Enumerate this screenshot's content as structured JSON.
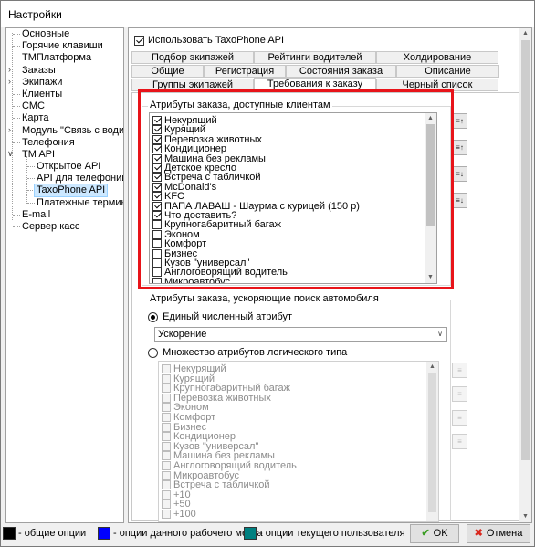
{
  "window": {
    "title": "Настройки"
  },
  "tree": [
    {
      "label": "Основные"
    },
    {
      "label": "Горячие клавиши"
    },
    {
      "label": "ТМПлатформа"
    },
    {
      "label": "Заказы"
    },
    {
      "label": "Экипажи"
    },
    {
      "label": "Клиенты"
    },
    {
      "label": "СМС"
    },
    {
      "label": "Карта"
    },
    {
      "label": "Модуль \"Связь с водителем\""
    },
    {
      "label": "Телефония"
    },
    {
      "label": "TM API"
    },
    {
      "label": "Открытое API"
    },
    {
      "label": "API для телефонии"
    },
    {
      "label": "TaxoPhone API"
    },
    {
      "label": "Платежные терминалы"
    },
    {
      "label": "E-mail"
    },
    {
      "label": "Сервер касс"
    }
  ],
  "use_api": {
    "label": "Использовать TaxoPhone API",
    "checked": true
  },
  "tabs": {
    "row1": [
      "Подбор экипажей",
      "Рейтинги водителей",
      "Холдирование"
    ],
    "row2": [
      "Общие",
      "Регистрация",
      "Состояния заказа",
      "Описание"
    ],
    "row3": [
      "Группы экипажей",
      "Требования к заказу",
      "Черный список"
    ],
    "active": "Требования к заказу"
  },
  "group1": {
    "title": "Атрибуты заказа, доступные клиентам",
    "items": [
      {
        "label": "Некурящий",
        "checked": true
      },
      {
        "label": "Курящий",
        "checked": true
      },
      {
        "label": "Перевозка животных",
        "checked": true
      },
      {
        "label": "Кондиционер",
        "checked": true
      },
      {
        "label": "Машина без рекламы",
        "checked": true
      },
      {
        "label": "Детское кресло",
        "checked": true
      },
      {
        "label": "Встреча с табличкой",
        "checked": true
      },
      {
        "label": "McDonald's",
        "checked": true
      },
      {
        "label": "KFC",
        "checked": true
      },
      {
        "label": "ПАПА ЛАВАШ - Шаурма с курицей (150 р)",
        "checked": true
      },
      {
        "label": "Что доставить?",
        "checked": true
      },
      {
        "label": "Крупногабаритный багаж",
        "checked": false
      },
      {
        "label": "Эконом",
        "checked": false
      },
      {
        "label": "Комфорт",
        "checked": false
      },
      {
        "label": "Бизнес",
        "checked": false
      },
      {
        "label": "Кузов \"универсал\"",
        "checked": false
      },
      {
        "label": "Англоговорящий водитель",
        "checked": false
      },
      {
        "label": "Микроавтобус",
        "checked": false
      }
    ]
  },
  "group2": {
    "title": "Атрибуты заказа, ускоряющие поиск автомобиля",
    "radio_single": "Единый численный атрибут",
    "radio_multi": "Множество атрибутов логического типа",
    "selected_radio": "single",
    "combo_value": "Ускорение",
    "items": [
      "Некурящий",
      "Курящий",
      "Крупногабаритный багаж",
      "Перевозка животных",
      "Эконом",
      "Комфорт",
      "Бизнес",
      "Кондиционер",
      "Кузов \"универсал\"",
      "Машина без рекламы",
      "Англоговорящий водитель",
      "Микроавтобус",
      "Встреча с табличкой",
      "+10",
      "+50",
      "+100"
    ]
  },
  "footer": {
    "legend": [
      {
        "label": "- общие опции",
        "color": "#000000"
      },
      {
        "label": "- опции данного рабочего места",
        "color": "#0000ff"
      },
      {
        "label": "- опции текущего пользователя",
        "color": "#008080"
      }
    ],
    "ok_label": "OK",
    "cancel_label": "Отмена"
  },
  "colors": {
    "highlight": "#e8141a",
    "selection": "#cce8ff"
  }
}
